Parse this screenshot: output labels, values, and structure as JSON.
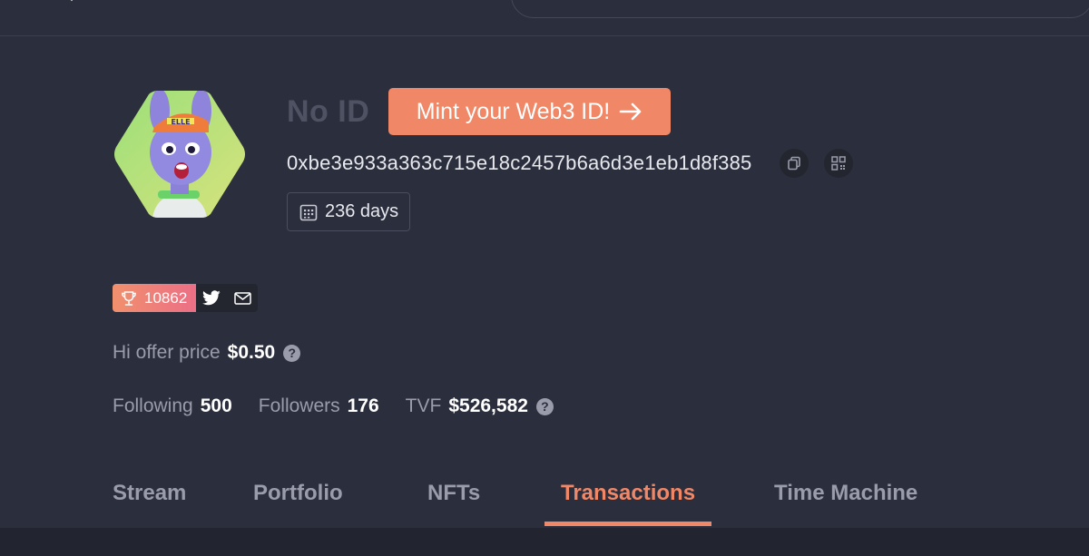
{
  "profile": {
    "name": "No ID",
    "mint_label": "Mint your Web3 ID!",
    "address": "0xbe3e933a363c715e18c2457b6a6d3e1eb1d8f385",
    "days": "236 days",
    "avatar_label": "ELLE"
  },
  "score": {
    "value": "10862"
  },
  "offer": {
    "label": "Hi offer price",
    "value": "$0.50"
  },
  "stats": {
    "following_label": "Following",
    "following_value": "500",
    "followers_label": "Followers",
    "followers_value": "176",
    "tvf_label": "TVF",
    "tvf_value": "$526,582"
  },
  "tabs": [
    {
      "label": "Stream"
    },
    {
      "label": "Portfolio"
    },
    {
      "label": "NFTs"
    },
    {
      "label": "Transactions",
      "active": true
    },
    {
      "label": "Time Machine"
    }
  ],
  "colors": {
    "background": "#2b2e3d",
    "accent": "#f08766",
    "muted": "#9a9cab"
  },
  "icons": {
    "copy": "copy-icon",
    "qr": "qr-code-icon",
    "calendar": "calendar-icon",
    "trophy": "trophy-icon",
    "twitter": "twitter-icon",
    "mail": "mail-icon",
    "help": "help-icon"
  }
}
